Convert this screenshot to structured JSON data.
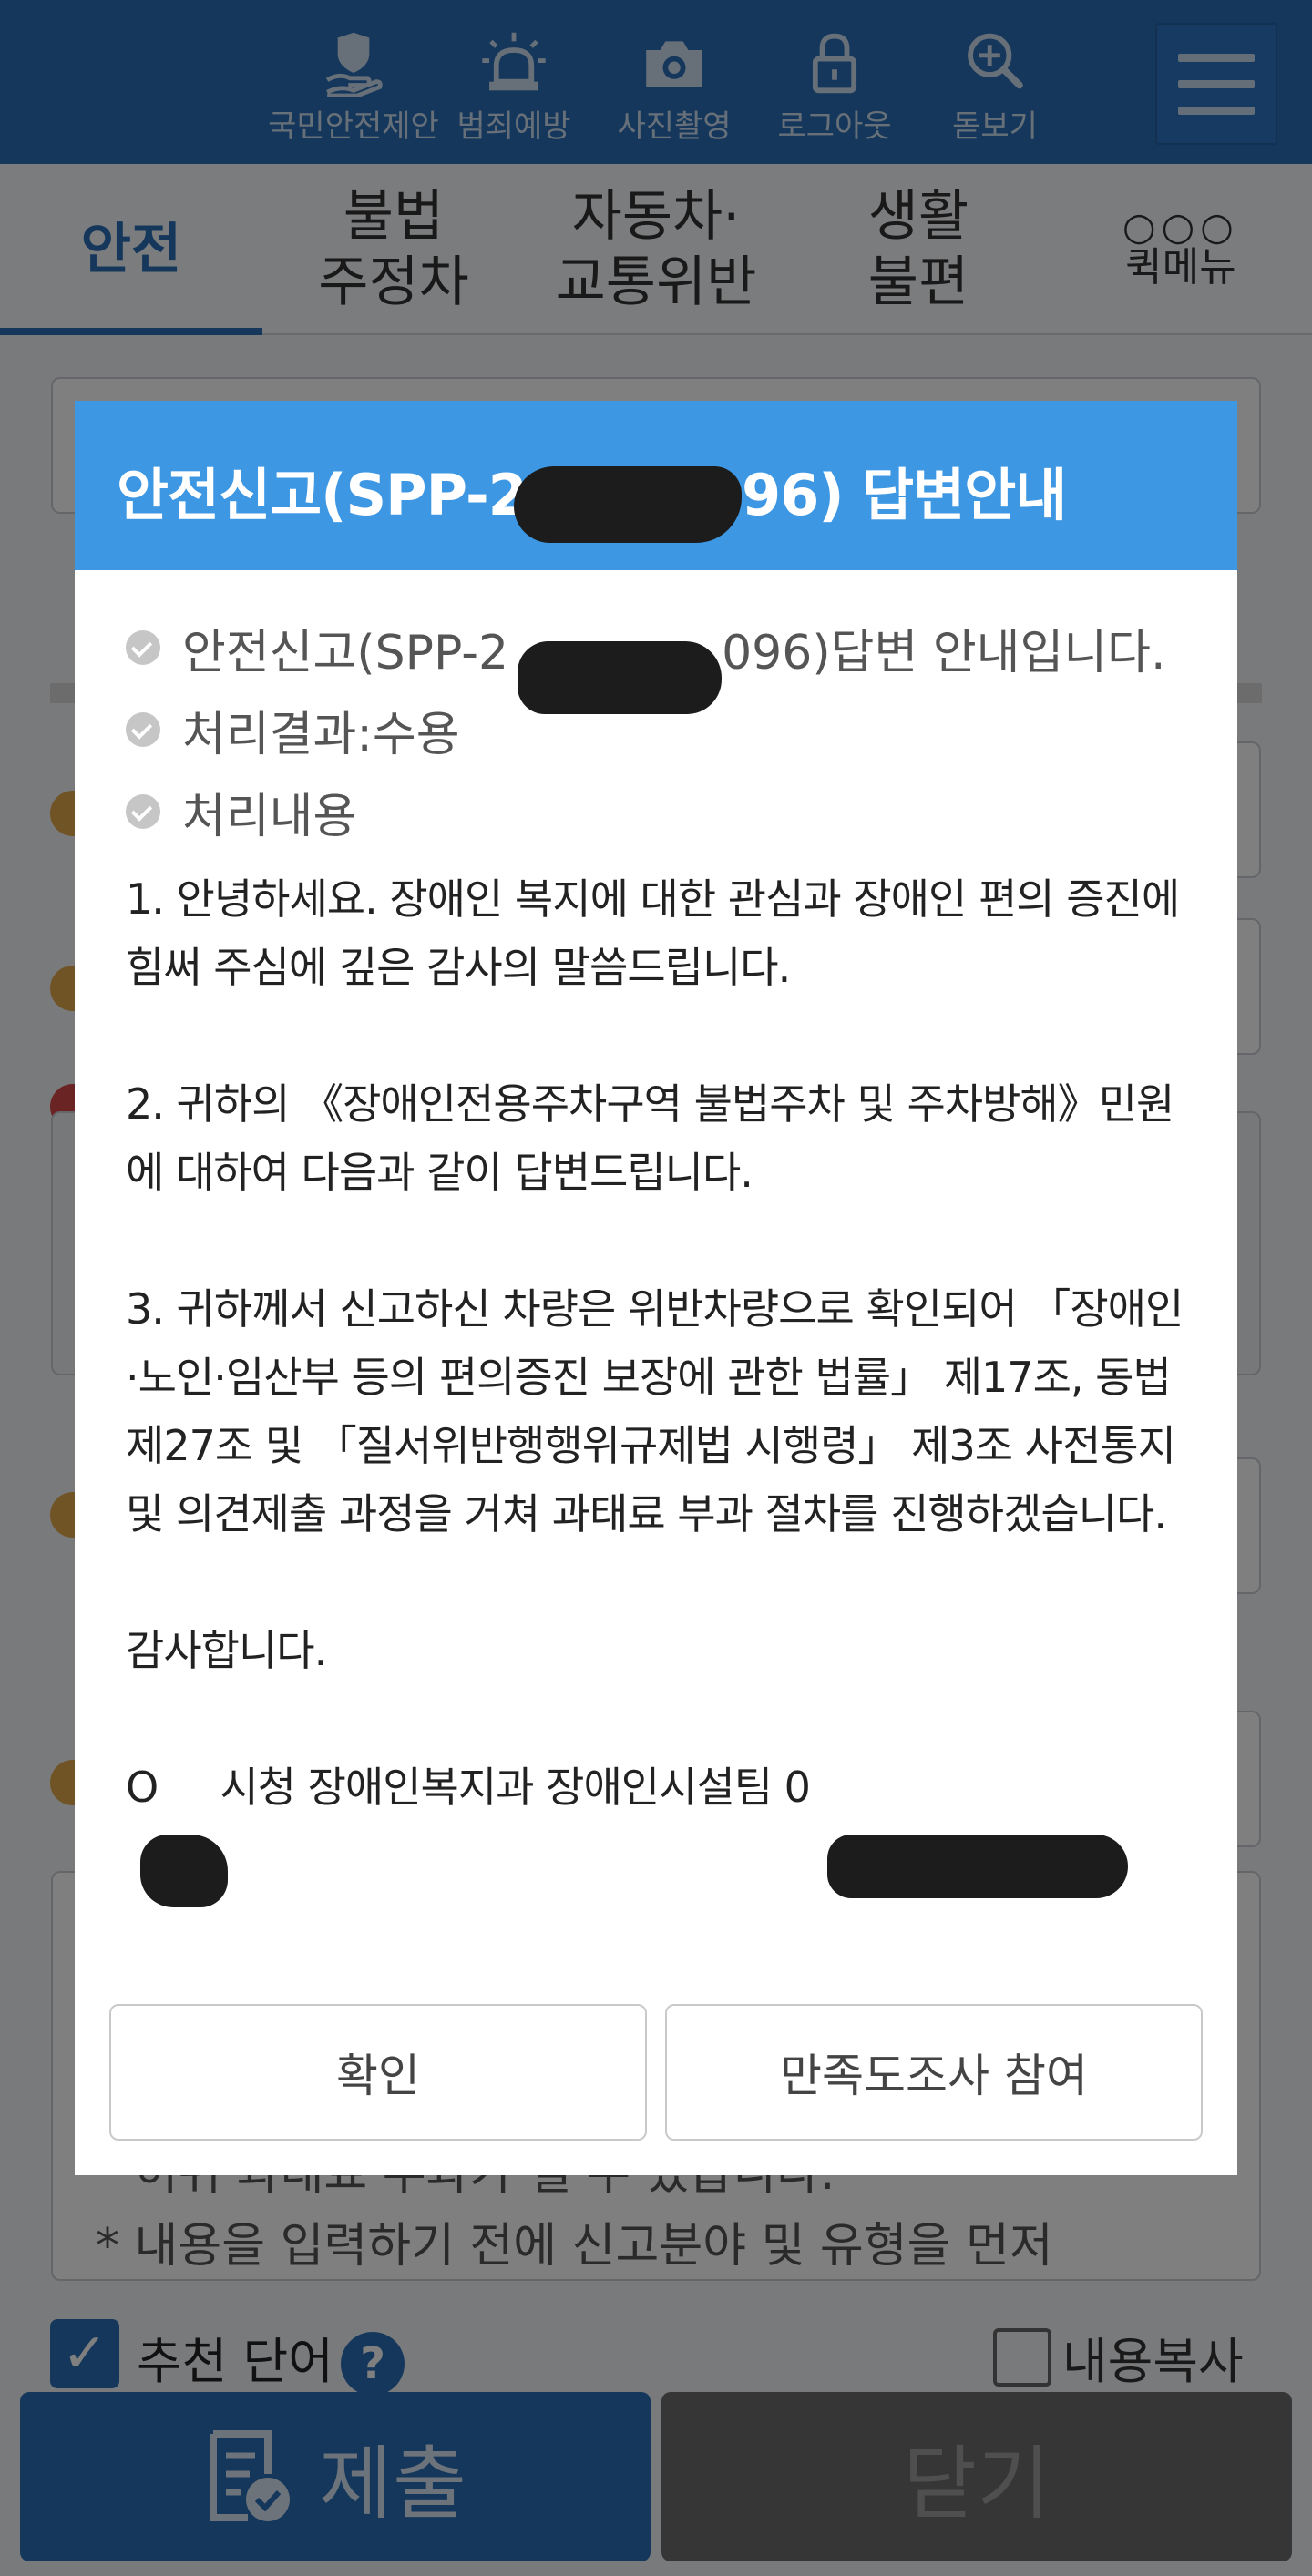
{
  "header": {
    "icons": [
      {
        "name": "national-safety-icon",
        "label": "국민안전제안"
      },
      {
        "name": "crime-prevention-icon",
        "label": "범죄예방"
      },
      {
        "name": "camera-icon",
        "label": "사진촬영"
      },
      {
        "name": "logout-icon",
        "label": "로그아웃"
      },
      {
        "name": "zoom-icon",
        "label": "돋보기"
      }
    ]
  },
  "tabs": [
    {
      "label": "안전",
      "active": true
    },
    {
      "label": "불법\n주정차",
      "active": false
    },
    {
      "label": "자동차·\n교통위반",
      "active": false
    },
    {
      "label": "생활\n불편",
      "active": false
    },
    {
      "label": "퀵메뉴",
      "active": false
    }
  ],
  "background": {
    "notice_line1": "* 허위 과태료 부과가 될 수 있습니다.",
    "notice_line2": "* 내용을 입력하기 전에 신고분야 및 유형을 먼저",
    "recommend_label": "추천 단어",
    "help_label": "?",
    "copy_label": "내용복사",
    "submit_label": "제출",
    "close_label": "닫기"
  },
  "modal": {
    "title_pre": "안전신고(SPP-26",
    "title_post": "96) 답변안내",
    "info": [
      {
        "pre": "안전신고(SPP-2",
        "post": "096)답변 안내입니다."
      },
      {
        "pre": "처리결과:수용",
        "post": ""
      },
      {
        "pre": "처리내용",
        "post": ""
      }
    ],
    "paragraphs": [
      "1. 안녕하세요. 장애인 복지에 대한 관심과 장애인 편의 증진에 힘써 주심에 깊은 감사의 말씀드립니다.",
      "2. 귀하의 《장애인전용주차구역 불법주차 및 주차방해》민원에 대하여 다음과 같이 답변드립니다.",
      "3. 귀하께서 신고하신 차량은 위반차량으로 확인되어 「장애인·노인·임산부 등의 편의증진 보장에 관한 법률」 제17조, 동법 제27조 및 「질서위반행행위규제법 시행령」 제3조 사전통지 및 의견제출 과정을 거쳐 과태료 부과 절차를 진행하겠습니다.",
      "감사합니다.",
      "O     시청 장애인복지과 장애인시설팀 0"
    ],
    "confirm_label": "확인",
    "survey_label": "만족도조사 참여"
  },
  "colors": {
    "brand_blue": "#2a6fb8",
    "modal_header": "#3d97e3",
    "close_gray": "#6d6d6d"
  }
}
